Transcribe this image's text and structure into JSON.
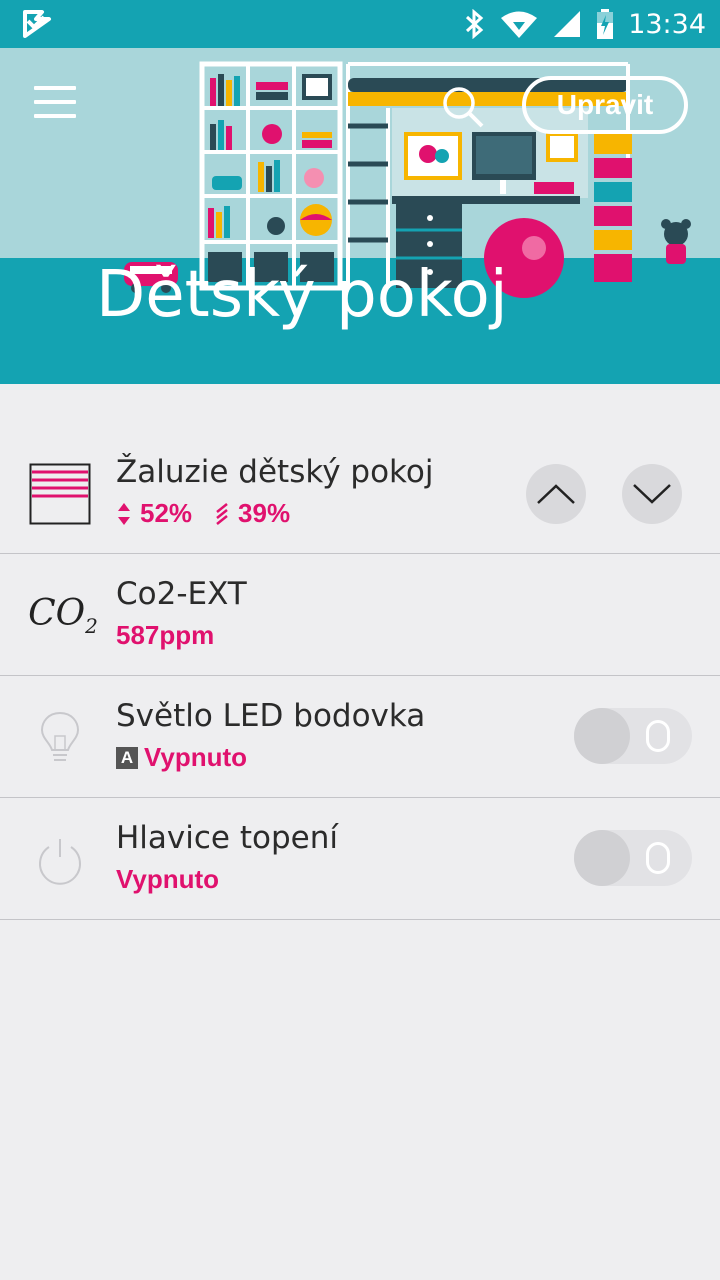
{
  "status_bar": {
    "time": "13:34"
  },
  "header": {
    "edit_label": "Upravit",
    "room_title": "Dětský pokoj"
  },
  "devices": [
    {
      "name": "Žaluzie dětský pokoj",
      "position": "52%",
      "tilt": "39%",
      "icon": "blinds-icon"
    },
    {
      "name": "Co2-EXT",
      "value": "587ppm",
      "icon_text": "CO",
      "icon_sub": "2"
    },
    {
      "name": "Světlo LED bodovka",
      "mode_badge": "A",
      "state": "Vypnuto",
      "icon": "lightbulb-icon"
    },
    {
      "name": "Hlavice topení",
      "state": "Vypnuto",
      "icon": "power-icon"
    }
  ],
  "colors": {
    "accent": "#e0116e",
    "header": "#14a3b2"
  }
}
